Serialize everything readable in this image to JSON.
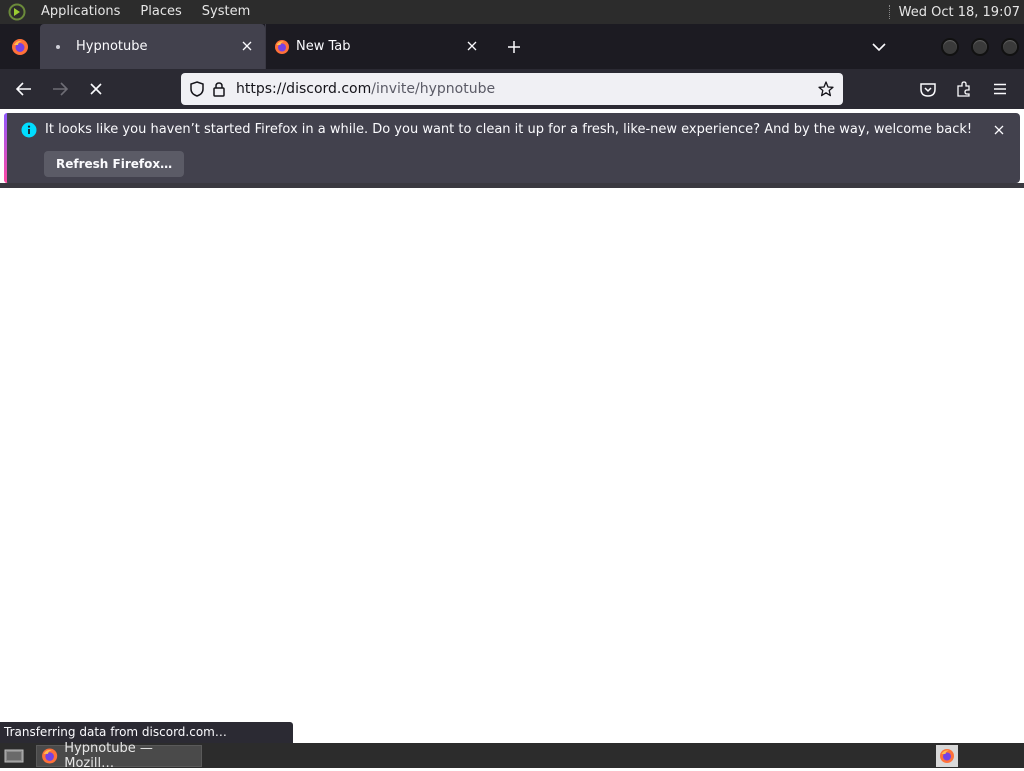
{
  "system_panel": {
    "menus": [
      "Applications",
      "Places",
      "System"
    ],
    "clock": "Wed Oct 18, 19:07"
  },
  "tabs": [
    {
      "title": "Hypnotube",
      "state": "loading"
    },
    {
      "title": "New Tab",
      "state": "idle"
    }
  ],
  "navbar": {
    "url_host": "https://discord.com",
    "url_path": "/invite/hypnotube"
  },
  "notification": {
    "message": "It looks like you haven’t started Firefox in a while. Do you want to clean it up for a fresh, like-new experience? And by the way, welcome back!",
    "button_label": "Refresh Firefox…"
  },
  "status_text": "Transferring data from discord.com…",
  "taskbar": {
    "window_title": "Hypnotube — Mozill…"
  },
  "colors": {
    "accent_gradient_start": "#9059ff",
    "accent_gradient_end": "#ff4aa2",
    "info_icon": "#00ddff"
  }
}
